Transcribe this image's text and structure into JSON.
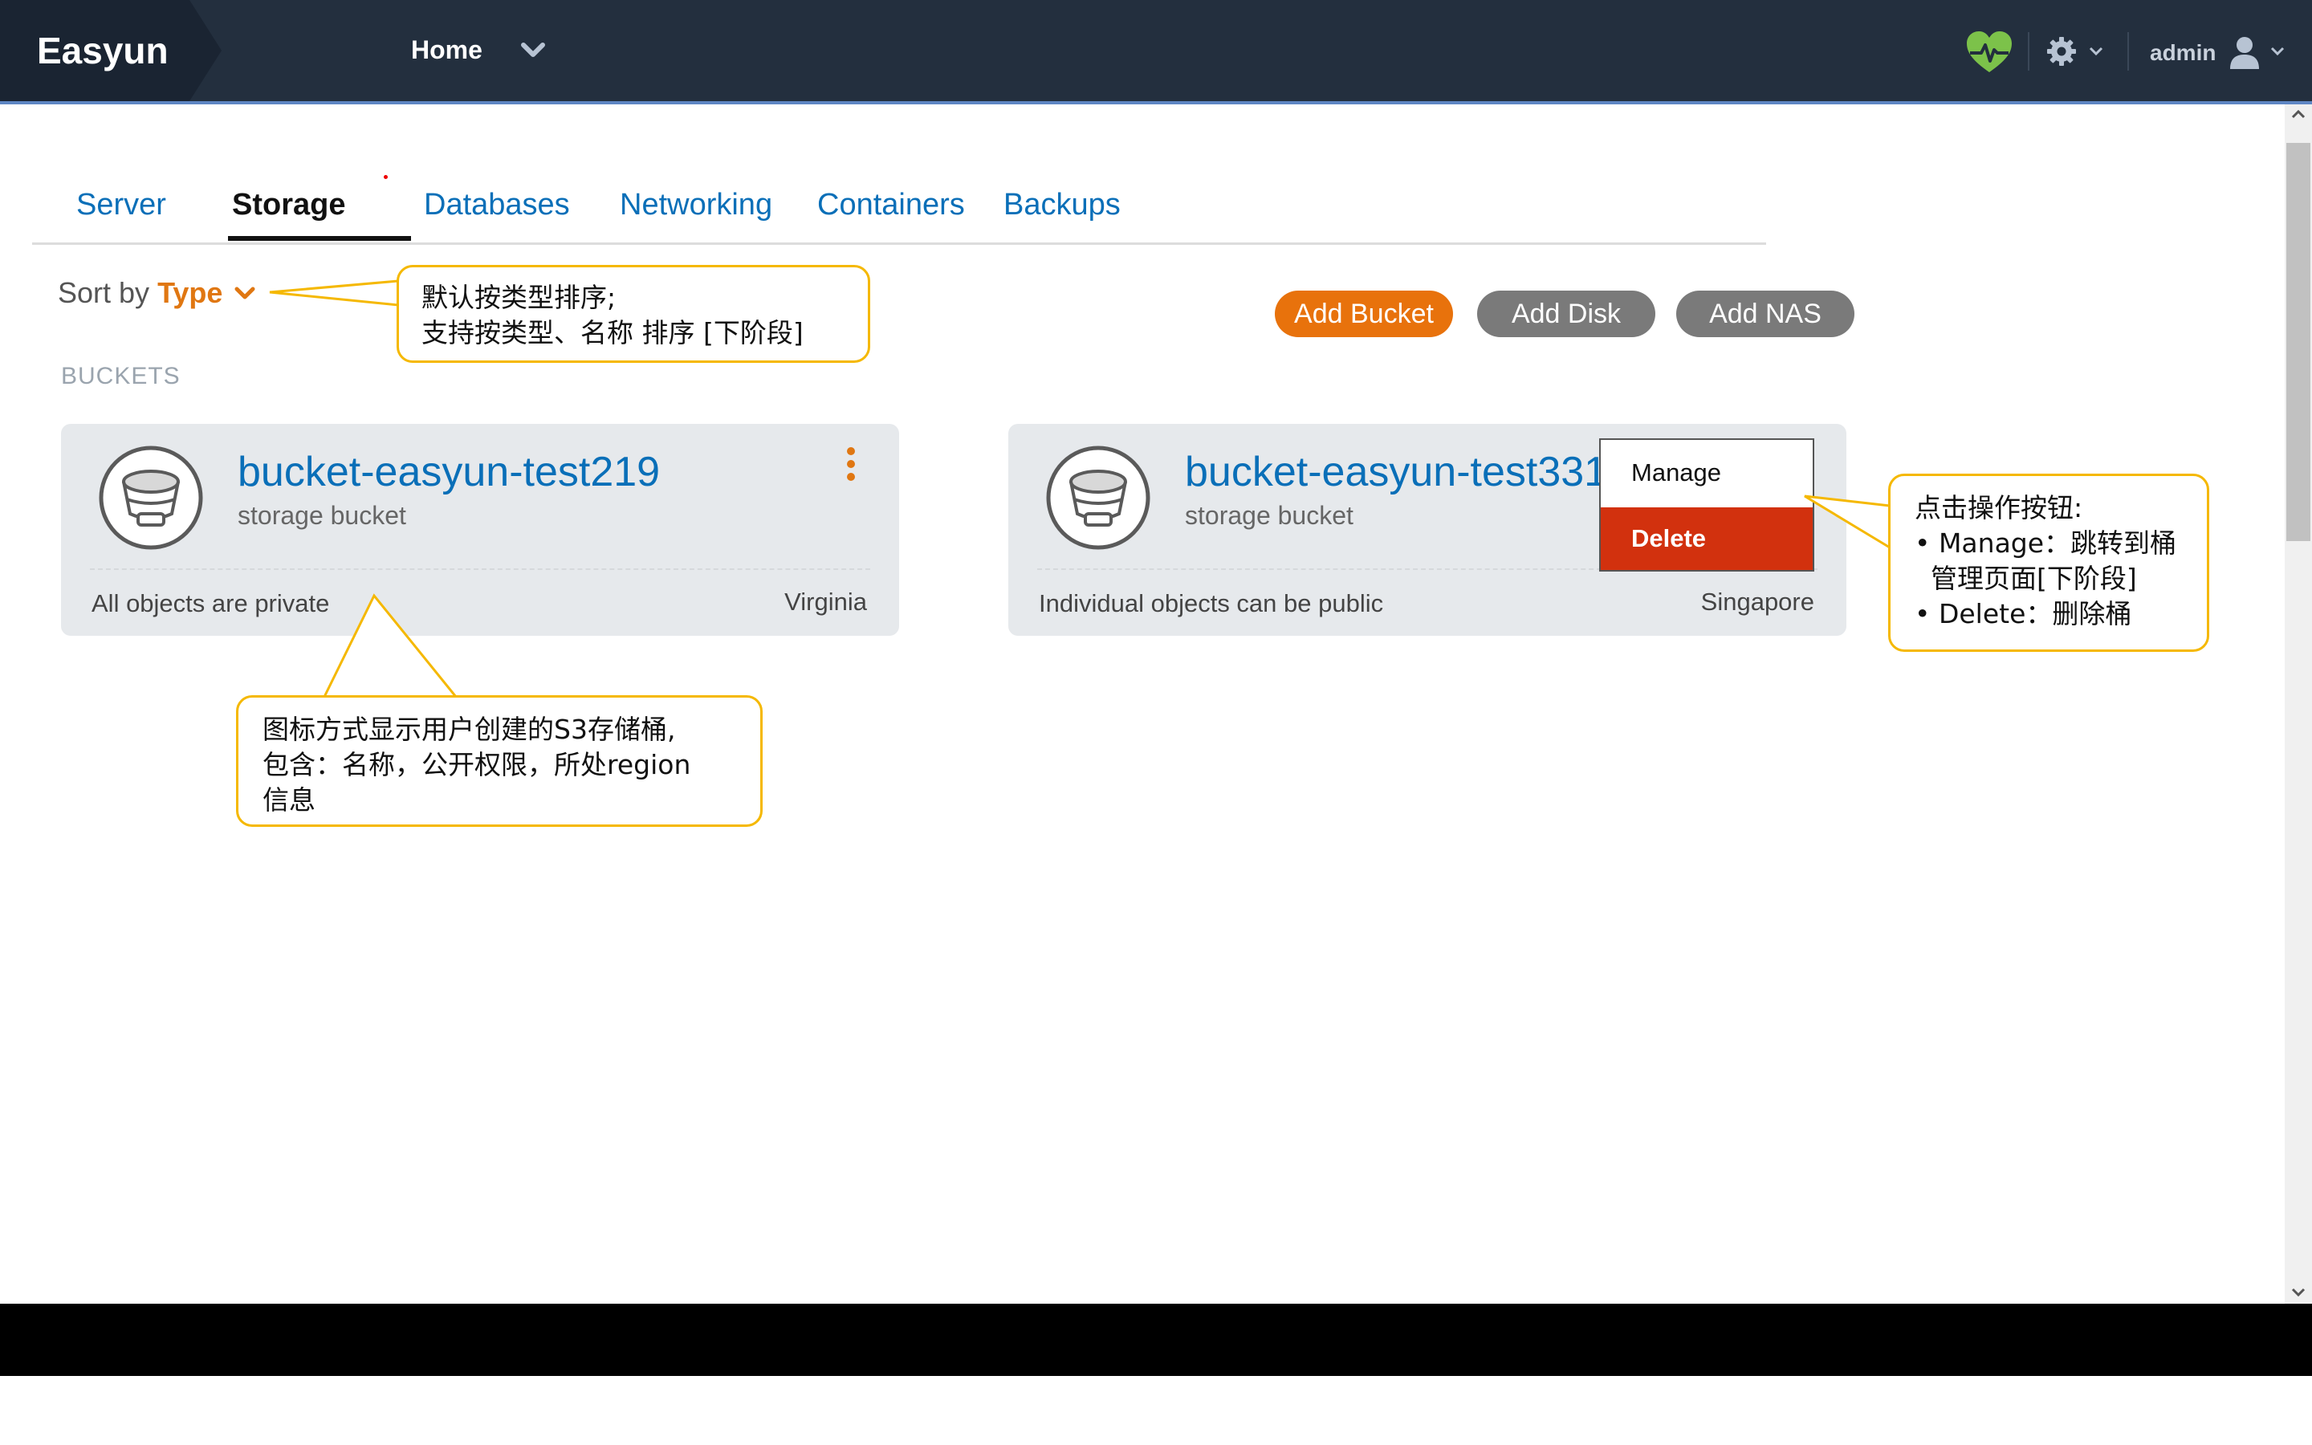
{
  "header": {
    "logo": "Easyun",
    "nav_home": "Home",
    "user": "admin",
    "health_color": "#7cc24a"
  },
  "tabs": [
    {
      "label": "Server"
    },
    {
      "label": "Storage",
      "active": true
    },
    {
      "label": "Databases"
    },
    {
      "label": "Networking"
    },
    {
      "label": "Containers"
    },
    {
      "label": "Backups"
    }
  ],
  "sort": {
    "prefix": "Sort by",
    "value": "Type"
  },
  "actions": {
    "add_bucket": "Add Bucket",
    "add_disk": "Add Disk",
    "add_nas": "Add NAS"
  },
  "section_label": "BUCKETS",
  "buckets": [
    {
      "name": "bucket-easyun-test219",
      "type": "storage bucket",
      "access": "All objects are private",
      "region": "Virginia"
    },
    {
      "name": "bucket-easyun-test331",
      "type": "storage bucket",
      "access": "Individual objects can be public",
      "region": "Singapore"
    }
  ],
  "dropdown": {
    "manage": "Manage",
    "delete": "Delete"
  },
  "callouts": {
    "sort_note": [
      "默认按类型排序;",
      "支持按类型、名称 排序 [下阶段]"
    ],
    "card_note": [
      "图标方式显示用户创建的S3存储桶,",
      "包含：名称，公开权限，所处region",
      "信息"
    ],
    "action_note": [
      "点击操作按钮:",
      "• Manage：跳转到桶",
      "管理页面[下阶段]",
      "• Delete：删除桶"
    ]
  },
  "colors": {
    "accent": "#e8720c",
    "link": "#0a6fb8",
    "danger": "#d2310e",
    "header_bg": "#232f3e",
    "callout_border": "#f5b800"
  }
}
